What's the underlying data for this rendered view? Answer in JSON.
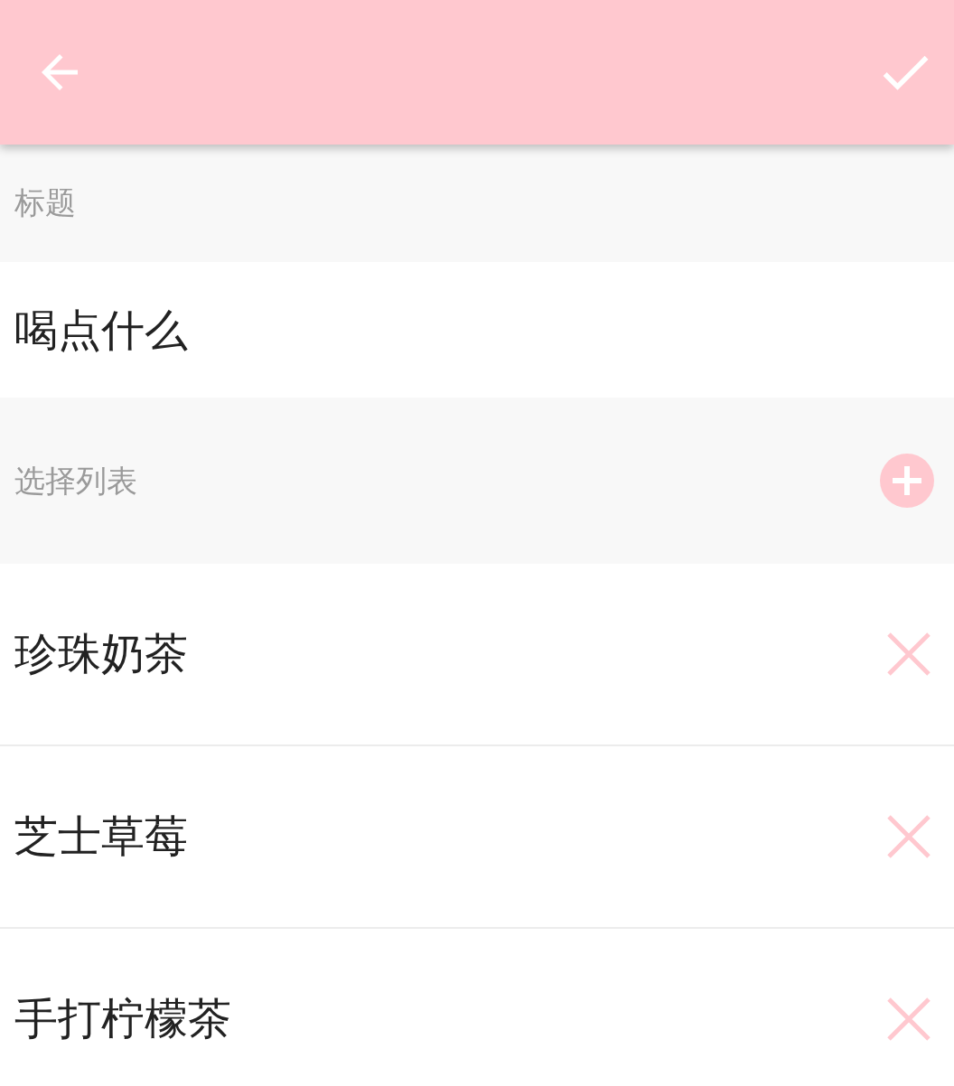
{
  "title_section": {
    "label": "标题",
    "value": "喝点什么"
  },
  "list_section": {
    "label": "选择列表"
  },
  "items": [
    {
      "label": "珍珠奶茶"
    },
    {
      "label": "芝士草莓"
    },
    {
      "label": "手打柠檬茶"
    }
  ]
}
